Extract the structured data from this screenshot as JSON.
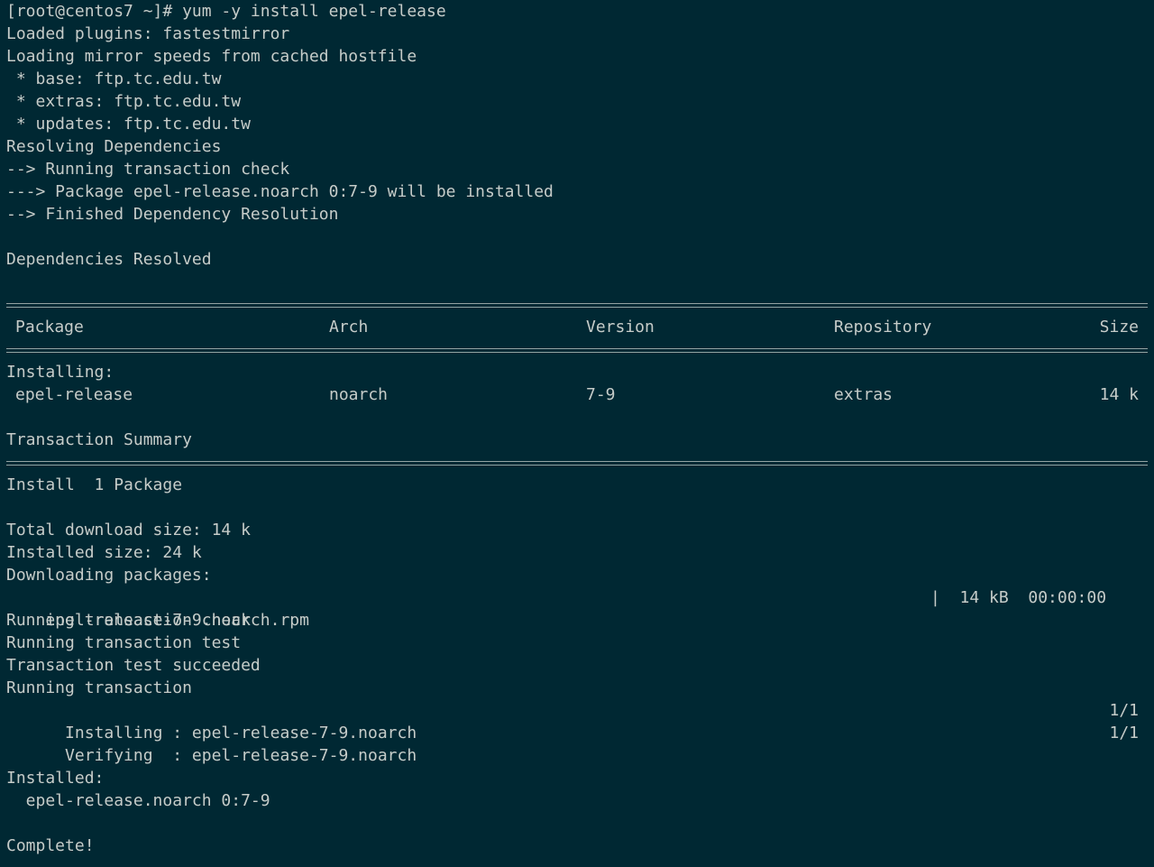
{
  "terminal": {
    "prompt_line": "[root@centos7 ~]# yum -y install epel-release",
    "header_lines": [
      "Loaded plugins: fastestmirror",
      "Loading mirror speeds from cached hostfile",
      " * base: ftp.tc.edu.tw",
      " * extras: ftp.tc.edu.tw",
      " * updates: ftp.tc.edu.tw",
      "Resolving Dependencies",
      "--> Running transaction check",
      "---> Package epel-release.noarch 0:7-9 will be installed",
      "--> Finished Dependency Resolution"
    ],
    "deps_resolved": "Dependencies Resolved",
    "table": {
      "headers": {
        "package": "Package",
        "arch": "Arch",
        "version": "Version",
        "repository": "Repository",
        "size": "Size"
      },
      "section": "Installing:",
      "row": {
        "package": "epel-release",
        "arch": "noarch",
        "version": "7-9",
        "repository": "extras",
        "size": "14 k"
      }
    },
    "summary_title": "Transaction Summary",
    "install_count": "Install  1 Package",
    "total_download": "Total download size: 14 k",
    "installed_size": "Installed size: 24 k",
    "downloading": "Downloading packages:",
    "download_file": "epel-release-7-9.noarch.rpm",
    "download_stats": "|  14 kB  00:00:00",
    "trans_lines": [
      "Running transaction check",
      "Running transaction test",
      "Transaction test succeeded",
      "Running transaction"
    ],
    "installing_step": "  Installing : epel-release-7-9.noarch",
    "installing_frac": "1/1",
    "verifying_step": "  Verifying  : epel-release-7-9.noarch",
    "verifying_frac": "1/1",
    "installed_label": "Installed:",
    "installed_pkg": "  epel-release.noarch 0:7-9",
    "complete": "Complete!"
  },
  "colors": {
    "background": "#002833",
    "foreground": "#c6ccc9"
  }
}
